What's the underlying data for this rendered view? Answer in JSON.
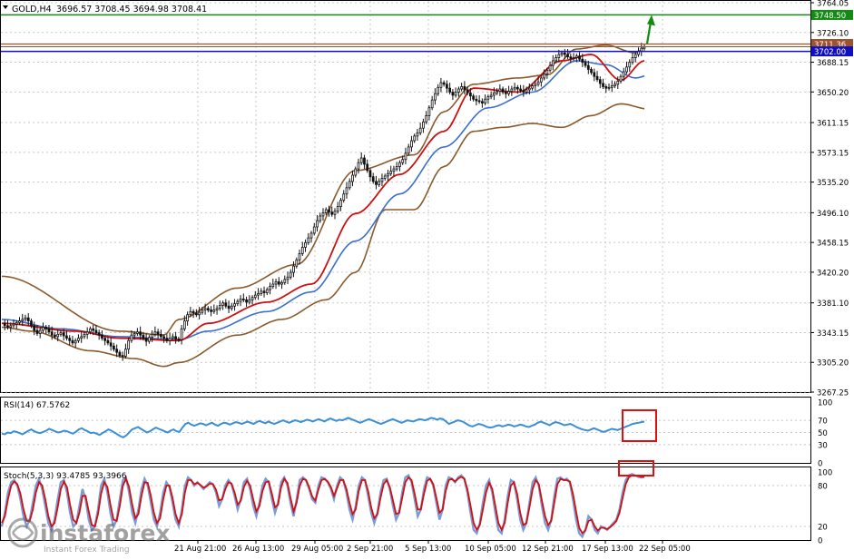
{
  "header": {
    "symbol": "GOLD,H4",
    "ohlc": "3696.57 3708.45 3694.98 3708.41"
  },
  "colors": {
    "bull": "#1a1a1a",
    "bear": "#1a1a1a",
    "ma_fast": "#cc1111",
    "ma_slow": "#3a6fcf",
    "bollinger": "#8b5a2b",
    "support_line": "#1010c0",
    "resistance_green": "#138a13",
    "level_brown": "#a0522d",
    "rsi": "#3a8fd6",
    "stoch_main": "#7a9bd8",
    "stoch_signal": "#d01010",
    "highlight_box": "#e01010",
    "arrow": "#138a13",
    "grid": "#c8c8c8"
  },
  "price_labels": {
    "green": "3748.50",
    "brown": "3711.36",
    "blue": "3702.00"
  },
  "rsi_label": "RSI(14) 67.5762",
  "stoch_label": "Stoch(5,3,3) 93.4785 93.3966",
  "watermark": {
    "brand": "instaforex",
    "sub": "Instant Forex Trading"
  },
  "chart_data": [
    {
      "type": "candlestick",
      "title": "GOLD,H4",
      "ylim": [
        3267.25,
        3764.05
      ],
      "y_ticks": [
        "3764.05",
        "3726.10",
        "3688.15",
        "3650.20",
        "3611.15",
        "3573.15",
        "3535.20",
        "3496.10",
        "3458.15",
        "3420.20",
        "3381.10",
        "3343.15",
        "3305.20",
        "3267.25"
      ],
      "x_ticks": [
        "21 Aug 21:00",
        "26 Aug 13:00",
        "29 Aug 05:00",
        "2 Sep 21:00",
        "5 Sep 13:00",
        "10 Sep 05:00",
        "12 Sep 21:00",
        "17 Sep 13:00",
        "22 Sep 05:00"
      ],
      "price_points": [
        3355,
        3352,
        3350,
        3352,
        3354,
        3356,
        3358,
        3360,
        3362,
        3358,
        3352,
        3346,
        3342,
        3346,
        3350,
        3348,
        3344,
        3340,
        3338,
        3341,
        3343,
        3339,
        3336,
        3333,
        3330,
        3333,
        3336,
        3338,
        3341,
        3344,
        3348,
        3346,
        3343,
        3340,
        3336,
        3333,
        3330,
        3326,
        3322,
        3318,
        3314,
        3313,
        3322,
        3333,
        3340,
        3342,
        3344,
        3340,
        3336,
        3332,
        3337,
        3341,
        3344,
        3341,
        3338,
        3336,
        3333,
        3336,
        3338,
        3335,
        3334,
        3348,
        3358,
        3366,
        3370,
        3368,
        3366,
        3369,
        3372,
        3374,
        3372,
        3370,
        3372,
        3374,
        3378,
        3381,
        3377,
        3374,
        3377,
        3380,
        3383,
        3386,
        3385,
        3382,
        3385,
        3388,
        3391,
        3393,
        3396,
        3394,
        3398,
        3402,
        3405,
        3408,
        3405,
        3407,
        3411,
        3414,
        3420,
        3428,
        3436,
        3444,
        3452,
        3458,
        3464,
        3470,
        3478,
        3486,
        3492,
        3496,
        3500,
        3497,
        3494,
        3498,
        3504,
        3512,
        3520,
        3528,
        3536,
        3544,
        3552,
        3560,
        3566,
        3558,
        3550,
        3542,
        3536,
        3532,
        3536,
        3540,
        3543,
        3546,
        3549,
        3552,
        3555,
        3560,
        3564,
        3572,
        3580,
        3588,
        3594,
        3598,
        3604,
        3612,
        3620,
        3630,
        3640,
        3648,
        3656,
        3662,
        3660,
        3655,
        3650,
        3646,
        3650,
        3654,
        3657,
        3653,
        3649,
        3645,
        3641,
        3639,
        3638,
        3636,
        3641,
        3644,
        3646,
        3649,
        3651,
        3654,
        3650,
        3648,
        3651,
        3654,
        3656,
        3654,
        3652,
        3650,
        3653,
        3655,
        3658,
        3660,
        3663,
        3668,
        3673,
        3678,
        3684,
        3690,
        3694,
        3698,
        3700,
        3698,
        3695,
        3693,
        3694,
        3696,
        3692,
        3688,
        3684,
        3679,
        3675,
        3670,
        3666,
        3661,
        3657,
        3655,
        3656,
        3658,
        3660,
        3664,
        3670,
        3676,
        3682,
        3688,
        3694,
        3698,
        3702,
        3706,
        3708
      ],
      "bollinger_upper_anchors": [
        [
          0,
          3415
        ],
        [
          40,
          3345
        ],
        [
          55,
          3340
        ],
        [
          60,
          3360
        ],
        [
          80,
          3400
        ],
        [
          100,
          3430
        ],
        [
          120,
          3550
        ],
        [
          140,
          3570
        ],
        [
          150,
          3625
        ],
        [
          160,
          3660
        ],
        [
          175,
          3668
        ],
        [
          185,
          3672
        ],
        [
          195,
          3705
        ],
        [
          205,
          3710
        ],
        [
          215,
          3700
        ],
        [
          220,
          3712
        ]
      ],
      "bollinger_lower_anchors": [
        [
          0,
          3350
        ],
        [
          10,
          3345
        ],
        [
          30,
          3320
        ],
        [
          45,
          3310
        ],
        [
          55,
          3300
        ],
        [
          60,
          3305
        ],
        [
          80,
          3340
        ],
        [
          95,
          3360
        ],
        [
          110,
          3385
        ],
        [
          120,
          3420
        ],
        [
          130,
          3500
        ],
        [
          140,
          3500
        ],
        [
          150,
          3555
        ],
        [
          160,
          3600
        ],
        [
          170,
          3605
        ],
        [
          180,
          3610
        ],
        [
          190,
          3605
        ],
        [
          200,
          3620
        ],
        [
          210,
          3635
        ],
        [
          220,
          3628
        ]
      ],
      "ma_slow_anchors": [
        [
          0,
          3360
        ],
        [
          20,
          3348
        ],
        [
          40,
          3338
        ],
        [
          60,
          3334
        ],
        [
          70,
          3345
        ],
        [
          90,
          3370
        ],
        [
          105,
          3395
        ],
        [
          120,
          3460
        ],
        [
          135,
          3520
        ],
        [
          150,
          3580
        ],
        [
          165,
          3630
        ],
        [
          180,
          3650
        ],
        [
          195,
          3690
        ],
        [
          205,
          3685
        ],
        [
          215,
          3668
        ],
        [
          220,
          3672
        ]
      ],
      "ma_fast_anchors": [
        [
          0,
          3355
        ],
        [
          25,
          3345
        ],
        [
          40,
          3336
        ],
        [
          60,
          3333
        ],
        [
          70,
          3355
        ],
        [
          90,
          3382
        ],
        [
          105,
          3405
        ],
        [
          120,
          3495
        ],
        [
          135,
          3545
        ],
        [
          150,
          3600
        ],
        [
          160,
          3655
        ],
        [
          175,
          3650
        ],
        [
          190,
          3690
        ],
        [
          200,
          3698
        ],
        [
          210,
          3665
        ],
        [
          218,
          3690
        ],
        [
          220,
          3708
        ]
      ],
      "series": [
        {
          "name": "price"
        },
        {
          "name": "ma_fast"
        },
        {
          "name": "ma_slow"
        },
        {
          "name": "bollinger"
        }
      ]
    },
    {
      "type": "line",
      "title": "RSI(14) 67.5762",
      "ylim": [
        0,
        100
      ],
      "y_ticks": [
        "100",
        "70",
        "50",
        "30",
        "0"
      ],
      "levels": [
        70,
        50,
        30
      ],
      "values": [
        48,
        47,
        50,
        49,
        52,
        51,
        49,
        47,
        50,
        53,
        55,
        52,
        50,
        49,
        51,
        53,
        56,
        54,
        52,
        50,
        51,
        53,
        52,
        50,
        48,
        51,
        55,
        57,
        54,
        52,
        49,
        50,
        48,
        46,
        49,
        52,
        55,
        53,
        50,
        47,
        44,
        42,
        45,
        50,
        55,
        57,
        59,
        56,
        53,
        50,
        52,
        55,
        58,
        56,
        54,
        52,
        50,
        53,
        55,
        52,
        51,
        58,
        64,
        66,
        63,
        61,
        63,
        65,
        64,
        62,
        64,
        66,
        63,
        61,
        64,
        66,
        65,
        63,
        65,
        67,
        66,
        64,
        66,
        68,
        66,
        64,
        67,
        69,
        67,
        65,
        68,
        66,
        64,
        66,
        68,
        70,
        68,
        66,
        68,
        70,
        69,
        67,
        69,
        71,
        70,
        68,
        70,
        72,
        70,
        68,
        71,
        73,
        71,
        69,
        71,
        70,
        72,
        74,
        72,
        70,
        68,
        66,
        68,
        70,
        72,
        70,
        68,
        66,
        64,
        66,
        68,
        70,
        72,
        70,
        68,
        66,
        68,
        70,
        69,
        68,
        70,
        72,
        71,
        70,
        72,
        74,
        73,
        71,
        73,
        72,
        68,
        64,
        66,
        68,
        70,
        69,
        67,
        64,
        61,
        60,
        62,
        64,
        63,
        61,
        59,
        58,
        59,
        61,
        62,
        60,
        61,
        63,
        62,
        60,
        61,
        63,
        62,
        60,
        59,
        61,
        63,
        66,
        68,
        66,
        64,
        62,
        65,
        67,
        66,
        64,
        62,
        63,
        64,
        62,
        59,
        57,
        55,
        54,
        53,
        55,
        57,
        55,
        53,
        51,
        52,
        54,
        56,
        55,
        54,
        56,
        58,
        60,
        62,
        64,
        65,
        66,
        67,
        68
      ]
    },
    {
      "type": "line",
      "title": "Stoch(5,3,3) 93.4785 93.3966",
      "ylim": [
        0,
        100
      ],
      "y_ticks": [
        "100",
        "80",
        "20",
        "0"
      ],
      "levels": [
        80,
        20
      ],
      "series": [
        {
          "name": "main",
          "values": [
            20,
            40,
            70,
            85,
            88,
            80,
            60,
            35,
            20,
            30,
            55,
            80,
            90,
            75,
            50,
            25,
            15,
            30,
            60,
            85,
            88,
            70,
            40,
            20,
            25,
            50,
            75,
            60,
            30,
            15,
            20,
            45,
            80,
            90,
            70,
            40,
            20,
            30,
            60,
            88,
            92,
            70,
            40,
            25,
            45,
            75,
            90,
            80,
            55,
            30,
            20,
            40,
            70,
            85,
            78,
            55,
            30,
            20,
            45,
            80,
            92,
            88,
            80,
            85,
            80,
            75,
            80,
            85,
            82,
            70,
            50,
            60,
            80,
            88,
            82,
            65,
            45,
            60,
            85,
            90,
            75,
            50,
            35,
            55,
            80,
            90,
            85,
            60,
            40,
            55,
            85,
            92,
            80,
            55,
            35,
            60,
            88,
            92,
            88,
            75,
            60,
            55,
            80,
            92,
            90,
            85,
            75,
            60,
            80,
            92,
            88,
            70,
            45,
            30,
            50,
            80,
            92,
            88,
            65,
            40,
            25,
            40,
            70,
            88,
            90,
            75,
            50,
            30,
            40,
            70,
            92,
            95,
            85,
            60,
            35,
            45,
            75,
            92,
            90,
            80,
            55,
            30,
            45,
            80,
            92,
            90,
            85,
            92,
            95,
            90,
            70,
            40,
            15,
            10,
            25,
            55,
            80,
            88,
            70,
            40,
            15,
            10,
            30,
            65,
            88,
            85,
            60,
            30,
            15,
            25,
            55,
            85,
            92,
            80,
            50,
            25,
            15,
            30,
            65,
            90,
            92,
            88,
            90,
            85,
            60,
            30,
            10,
            5,
            15,
            35,
            30,
            15,
            10,
            20,
            18,
            15,
            20,
            25,
            30,
            45,
            70,
            88,
            95,
            97,
            95,
            93,
            92,
            93
          ]
        },
        {
          "name": "signal",
          "values": [
            25,
            35,
            60,
            80,
            86,
            82,
            68,
            45,
            28,
            28,
            45,
            70,
            85,
            80,
            60,
            35,
            20,
            25,
            48,
            75,
            86,
            78,
            52,
            30,
            25,
            40,
            65,
            65,
            42,
            22,
            20,
            38,
            68,
            85,
            78,
            52,
            30,
            28,
            50,
            80,
            90,
            78,
            52,
            32,
            38,
            65,
            85,
            84,
            65,
            40,
            25,
            32,
            60,
            80,
            80,
            62,
            38,
            25,
            38,
            70,
            88,
            88,
            82,
            84,
            81,
            77,
            79,
            83,
            82,
            74,
            58,
            60,
            75,
            85,
            83,
            70,
            52,
            58,
            78,
            87,
            80,
            60,
            42,
            50,
            72,
            85,
            86,
            68,
            48,
            52,
            78,
            90,
            84,
            62,
            42,
            55,
            80,
            90,
            88,
            78,
            64,
            58,
            74,
            88,
            90,
            86,
            78,
            65,
            76,
            88,
            88,
            75,
            55,
            38,
            45,
            72,
            88,
            88,
            72,
            48,
            32,
            38,
            62,
            82,
            88,
            78,
            58,
            38,
            40,
            62,
            85,
            92,
            88,
            68,
            45,
            45,
            68,
            87,
            90,
            82,
            62,
            40,
            45,
            72,
            88,
            90,
            86,
            90,
            93,
            90,
            75,
            50,
            25,
            15,
            22,
            45,
            70,
            84,
            75,
            50,
            25,
            15,
            25,
            55,
            80,
            85,
            68,
            40,
            22,
            25,
            48,
            75,
            88,
            82,
            58,
            35,
            22,
            28,
            55,
            82,
            90,
            88,
            88,
            86,
            68,
            42,
            18,
            10,
            14,
            28,
            30,
            20,
            14,
            18,
            18,
            16,
            19,
            23,
            28,
            40,
            62,
            82,
            92,
            95,
            95,
            94,
            93,
            93
          ]
        }
      ]
    }
  ]
}
